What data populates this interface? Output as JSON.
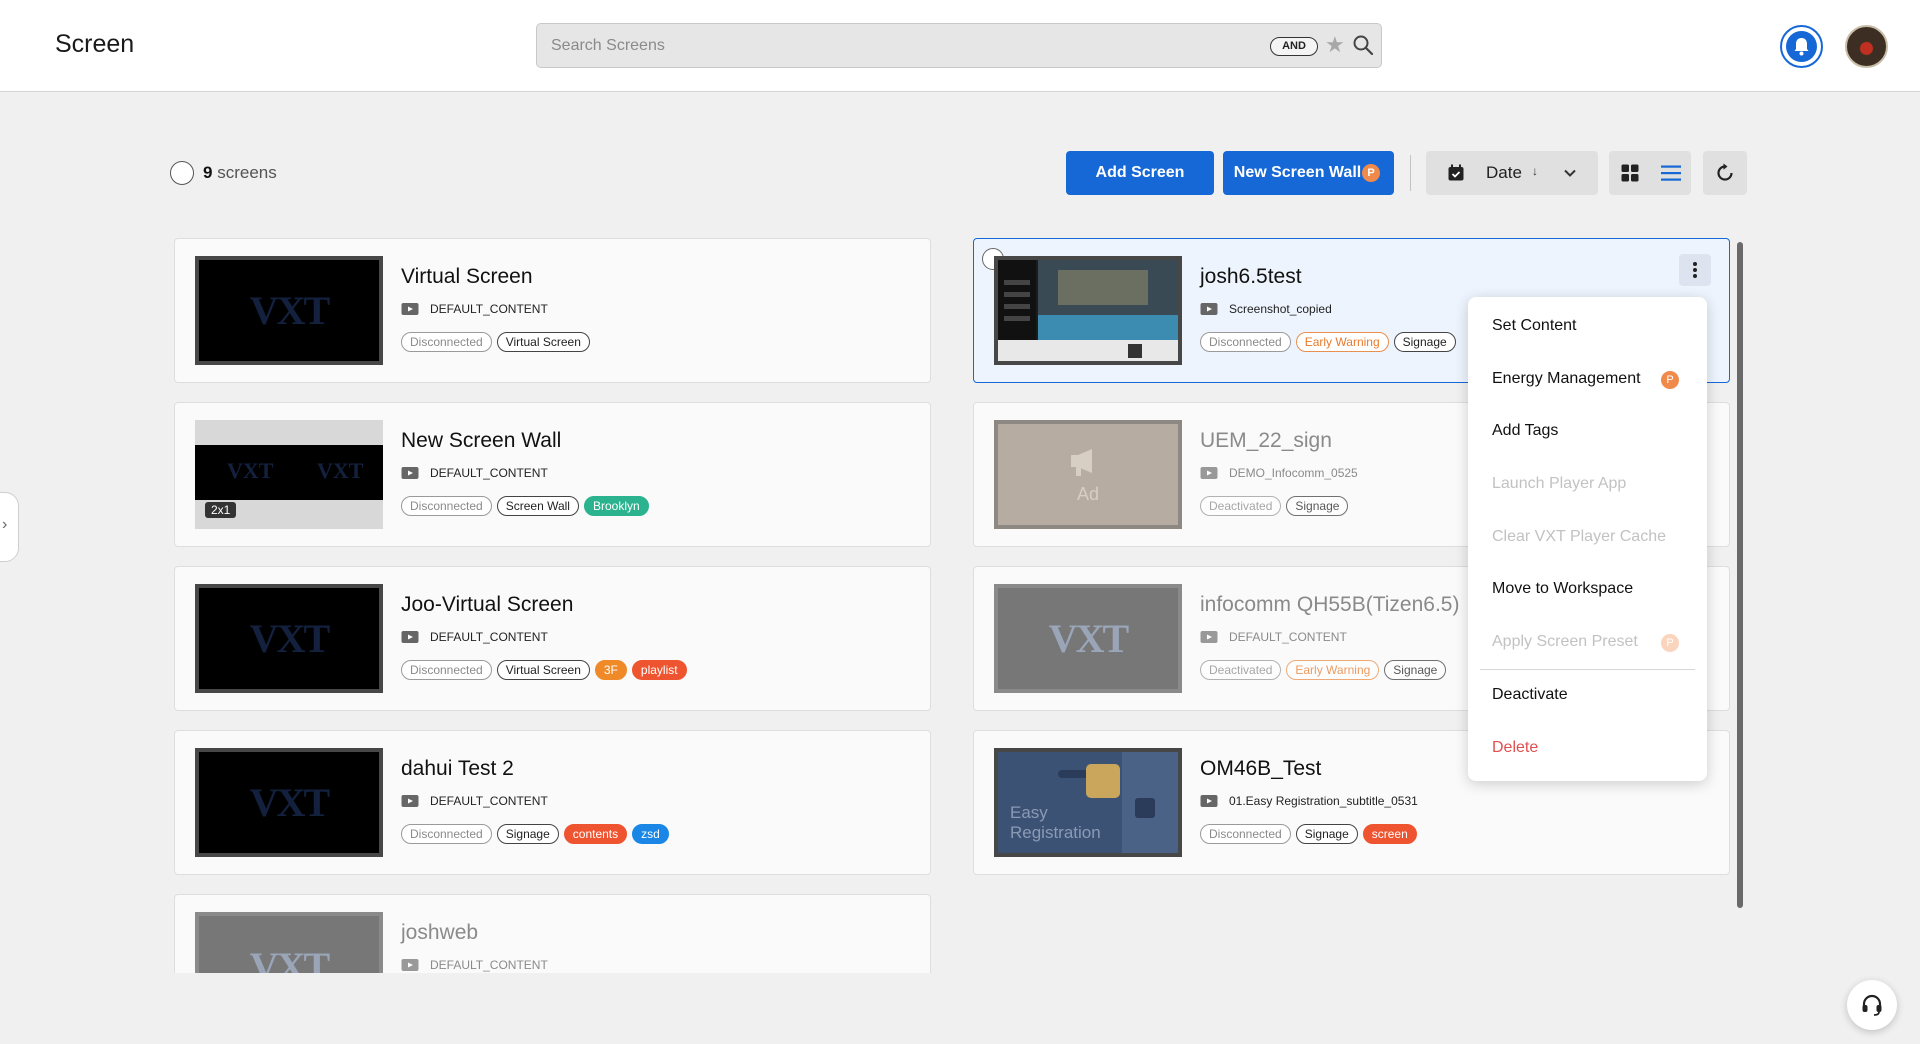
{
  "app": {
    "title": "Screen"
  },
  "search": {
    "placeholder": "Search Screens",
    "and_label": "AND"
  },
  "toolbar": {
    "count_number": "9",
    "count_label": "screens",
    "add_screen_label": "Add Screen",
    "new_screen_wall_label": "New Screen Wall",
    "premium_badge": "P",
    "sort_label": "Date",
    "sort_direction_glyph": "↓"
  },
  "screens_left": [
    {
      "name": "Virtual Screen",
      "content": "DEFAULT_CONTENT",
      "thumb": "VXT",
      "tags": [
        "Disconnected",
        "Virtual Screen"
      ]
    },
    {
      "name": "New Screen Wall",
      "content": "DEFAULT_CONTENT",
      "thumb": "VXT",
      "wall_size": "2x1",
      "tags": [
        "Disconnected",
        "Screen Wall",
        "Brooklyn"
      ]
    },
    {
      "name": "Joo-Virtual Screen",
      "content": "DEFAULT_CONTENT",
      "thumb": "VXT",
      "tags": [
        "Disconnected",
        "Virtual Screen",
        "3F",
        "playlist"
      ]
    },
    {
      "name": "dahui Test 2",
      "content": "DEFAULT_CONTENT",
      "thumb": "VXT",
      "tags": [
        "Disconnected",
        "Signage",
        "contents",
        "zsd"
      ]
    },
    {
      "name": "joshweb",
      "content": "DEFAULT_CONTENT",
      "thumb": "VXT",
      "tags": []
    }
  ],
  "screens_right": [
    {
      "name": "josh6.5test",
      "content": "Screenshot_copied",
      "tags": [
        "Disconnected",
        "Early Warning",
        "Signage"
      ]
    },
    {
      "name": "UEM_22_sign",
      "content": "DEMO_Infocomm_0525",
      "thumb": "Ad",
      "tags": [
        "Deactivated",
        "Signage"
      ]
    },
    {
      "name": "infocomm QH55B(Tizen6.5)",
      "content": "DEFAULT_CONTENT",
      "thumb": "VXT",
      "tags": [
        "Deactivated",
        "Early Warning",
        "Signage"
      ]
    },
    {
      "name": "OM46B_Test",
      "content": "01.Easy Registration_subtitle_0531",
      "thumb": "Easy Registration",
      "tags": [
        "Disconnected",
        "Signage",
        "screen"
      ]
    }
  ],
  "context_menu": {
    "items": [
      {
        "label": "Set Content",
        "enabled": true
      },
      {
        "label": "Energy Management",
        "enabled": true,
        "badge": "P"
      },
      {
        "label": "Add Tags",
        "enabled": true
      },
      {
        "label": "Launch Player App",
        "enabled": false
      },
      {
        "label": "Clear VXT Player Cache",
        "enabled": false
      },
      {
        "label": "Move to Workspace",
        "enabled": true
      },
      {
        "label": "Apply Screen Preset",
        "enabled": false,
        "badge": "P"
      },
      {
        "label": "Deactivate",
        "enabled": true
      },
      {
        "label": "Delete",
        "enabled": true,
        "danger": true
      }
    ]
  },
  "colors": {
    "primary": "#1668d6",
    "premium": "#f08a4b",
    "danger": "#e05050",
    "warning": "#e87a2e"
  }
}
